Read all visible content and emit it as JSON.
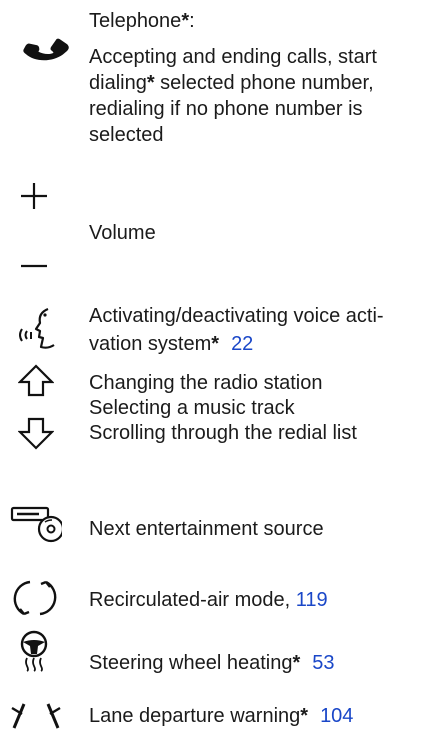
{
  "telephone": {
    "title": "Telephone",
    "title_mark": "*",
    "title_colon": ":",
    "desc_line1": "Accepting and ending calls, start",
    "desc_line2_a": "dialing",
    "desc_line2_mark": "*",
    "desc_line2_b": " selected phone number,",
    "desc_line3": "redialing if no phone number is",
    "desc_line4": "selected",
    "icon": "phone-handset-icon"
  },
  "volume": {
    "label": "Volume",
    "icon_up": "plus-icon",
    "icon_down": "minus-icon"
  },
  "voice": {
    "line1": "Activating/deactivating voice acti-",
    "line2": "vation system",
    "mark": "*",
    "page_ref": "22",
    "icon": "voice-command-icon"
  },
  "arrows": {
    "line1": "Changing the radio station",
    "line2": "Selecting a music track",
    "line3": "Scrolling through the redial list",
    "icon_up": "arrow-up-outline-icon",
    "icon_down": "arrow-down-outline-icon"
  },
  "source": {
    "label": "Next entertainment source",
    "icon": "entertainment-source-icon"
  },
  "recirc": {
    "label": "Recirculated-air mode, ",
    "page_ref": "119",
    "icon": "recirculated-air-icon"
  },
  "heating": {
    "label": "Steering wheel heating",
    "mark": "*",
    "page_ref": "53",
    "icon": "steering-wheel-heating-icon"
  },
  "lane": {
    "label": "Lane departure warning",
    "mark": "*",
    "page_ref": "104",
    "icon": "lane-departure-icon"
  },
  "colors": {
    "text": "#1b1b1b",
    "link": "#1a47c8"
  }
}
